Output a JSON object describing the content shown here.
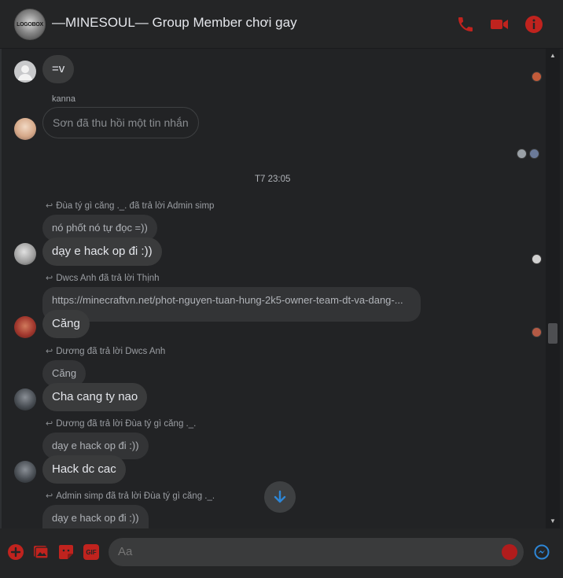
{
  "colors": {
    "accent": "#c0231e",
    "messenger_blue": "#2d86d6",
    "bubble": "#3a3b3c"
  },
  "header": {
    "group_avatar_text": "LOGOBOX",
    "title": "—MINESOUL— Group Member chơi gay",
    "icons": [
      "phone-icon",
      "video-call-icon",
      "info-icon"
    ]
  },
  "messages": [
    {
      "id": "m1",
      "text": "=v"
    },
    {
      "id": "m2",
      "sender": "kanna",
      "text": "Sơn đã thu hồi một tin nhắn"
    },
    {
      "id": "ts",
      "text": "T7 23:05"
    },
    {
      "id": "m3",
      "reply_label": "Đùa tý gì căng ._. đã trả lời Admin simp",
      "quoted": "nó phốt nó tự đọc =))",
      "text": "dạy e hack op đi :))"
    },
    {
      "id": "m4",
      "reply_label": "Dwcs Anh đã trả lời Thịnh",
      "quoted": "https://minecraftvn.net/phot-nguyen-tuan-hung-2k5-owner-team-dt-va-dang-...",
      "text": "Căng"
    },
    {
      "id": "m5",
      "reply_label": "Dương đã trả lời Dwcs Anh",
      "quoted": "Căng",
      "text": "Cha cang ty nao"
    },
    {
      "id": "m6",
      "reply_label": "Dương đã trả lời Đùa tý gì căng ._.",
      "quoted": "dạy e hack op đi :))",
      "text": "Hack dc cac"
    },
    {
      "id": "m7",
      "reply_label": "Admin simp đã trả lời Đùa tý gì căng ._.",
      "quoted": "dạy e hack op đi :))"
    }
  ],
  "composer": {
    "placeholder": "Aa",
    "icons": [
      "add-icon",
      "image-icon",
      "sticker-icon",
      "gif-icon",
      "emoji-icon",
      "messenger-icon"
    ],
    "gif_label": "GIF"
  }
}
